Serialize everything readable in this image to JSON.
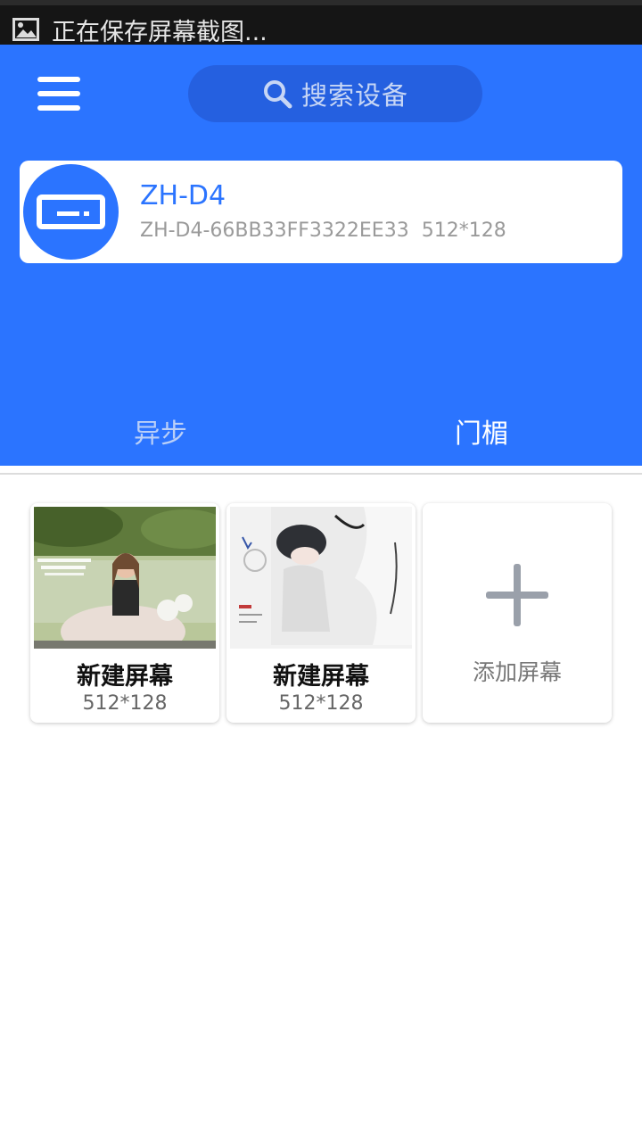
{
  "status_bar": {
    "notification_text": "正在保存屏幕截图...",
    "notification_icon": "image-icon"
  },
  "header": {
    "menu_icon": "hamburger-menu-icon",
    "search": {
      "icon": "search-icon",
      "placeholder": "搜索设备"
    }
  },
  "device": {
    "name": "ZH-D4",
    "id": "ZH-D4-66BB33FF3322EE33",
    "resolution": "512*128",
    "icon": "led-display-icon"
  },
  "tabs": [
    {
      "label": "异步",
      "selected": false
    },
    {
      "label": "门楣",
      "selected": true
    }
  ],
  "screens": [
    {
      "title": "新建屏幕",
      "resolution": "512*128",
      "thumbnail": "photo-thumbnail"
    },
    {
      "title": "新建屏幕",
      "resolution": "512*128",
      "thumbnail": "photo-thumbnail"
    }
  ],
  "add_screen": {
    "label": "添加屏幕",
    "icon": "plus-icon"
  },
  "colors": {
    "primary": "#2b74ff",
    "search_bg": "#2560e0",
    "tab_inactive": "#b9cff8"
  }
}
